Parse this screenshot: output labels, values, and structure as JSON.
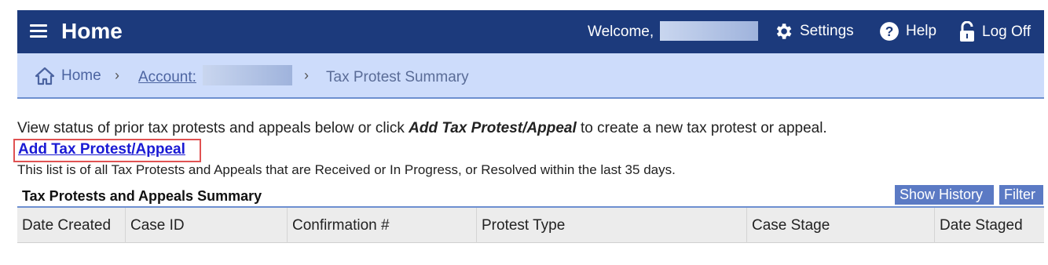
{
  "header": {
    "title": "Home",
    "welcome": "Welcome,",
    "settings": "Settings",
    "help": "Help",
    "logoff": "Log Off",
    "icons": [
      "menu-icon",
      "gear-icon",
      "help-icon",
      "lock-icon"
    ]
  },
  "breadcrumb": {
    "home": "Home",
    "account": "Account:",
    "current": "Tax Protest Summary",
    "separator": "›"
  },
  "intro": {
    "prefix": "View status of prior tax protests and appeals below or click ",
    "emphasis": "Add Tax Protest/Appeal",
    "suffix": " to create a new tax protest or appeal."
  },
  "add_link": "Add Tax Protest/Appeal",
  "list_note": "This list is of all Tax Protests and Appeals that are Received or In Progress, or Resolved within the last 35 days.",
  "summary": {
    "title": "Tax Protests and Appeals Summary",
    "show_history": "Show History",
    "filter": "Filter",
    "columns": [
      "Date Created",
      "Case ID",
      "Confirmation #",
      "Protest Type",
      "Case Stage",
      "Date Staged"
    ]
  },
  "colors": {
    "header_bg": "#1c3a7c",
    "breadcrumb_bg": "#cddcfb",
    "button_bg": "#5b7ac4",
    "link": "#1a1ad4",
    "highlight": "#e05252"
  }
}
